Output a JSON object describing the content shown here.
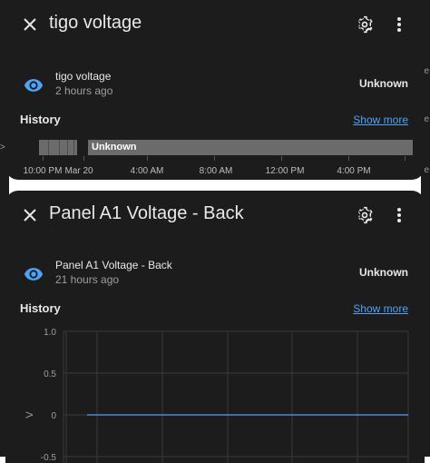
{
  "background": {
    "right_letters": [
      "e",
      "e",
      "e"
    ],
    "left_letters": [
      ">",
      "0"
    ]
  },
  "dialog1": {
    "title": "tigo voltage",
    "entity_name": "tigo voltage",
    "last_changed": "2 hours ago",
    "state": "Unknown",
    "history_title": "History",
    "show_more": "Show more",
    "timeline": {
      "segment_label": "Unknown",
      "axis_labels": [
        "10:00 PM",
        "Mar 20",
        "4:00 AM",
        "8:00 AM",
        "12:00 PM",
        "4:00 PM"
      ]
    }
  },
  "dialog2": {
    "title": "Panel A1 Voltage - Back",
    "entity_name": "Panel A1 Voltage - Back",
    "last_changed": "21 hours ago",
    "state": "Unknown",
    "history_title": "History",
    "show_more": "Show more"
  },
  "chart_data": {
    "type": "line",
    "title": "",
    "xlabel": "",
    "ylabel": "V",
    "ylim": [
      -0.5,
      1.0
    ],
    "y_ticks": [
      "1.0",
      "0.5",
      "0",
      "-0.5"
    ],
    "grid": true,
    "series": [
      {
        "values": [
          0,
          0,
          0,
          0,
          0,
          0
        ],
        "color": "#4fa3f7"
      }
    ]
  },
  "colors": {
    "dialog_bg": "#1c1c1c",
    "accent": "#4fa3f7",
    "timeline_unknown": "#6b6b6b"
  }
}
